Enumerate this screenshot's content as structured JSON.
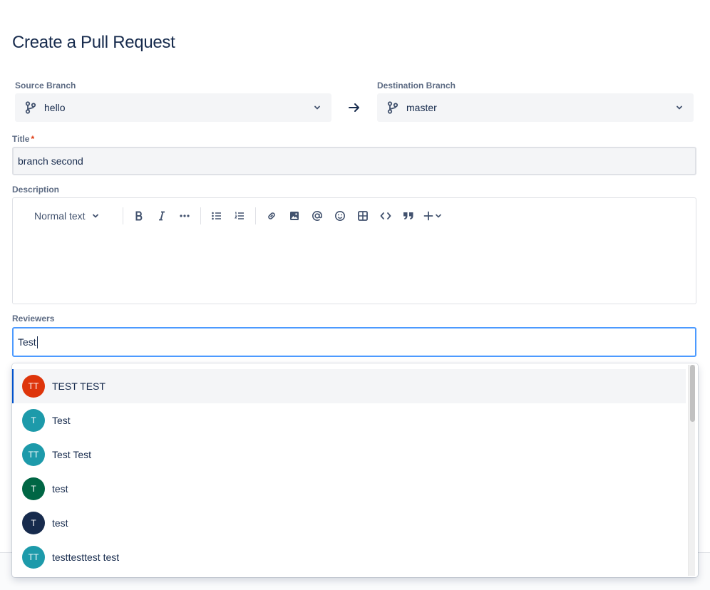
{
  "page": {
    "title": "Create a Pull Request"
  },
  "source_branch": {
    "label": "Source Branch",
    "value": "hello"
  },
  "destination_branch": {
    "label": "Destination Branch",
    "value": "master"
  },
  "title_field": {
    "label": "Title",
    "required_mark": "*",
    "value": "branch second"
  },
  "description": {
    "label": "Description",
    "toolbar": {
      "text_style": "Normal text",
      "buttons": [
        "bold-icon",
        "italic-icon",
        "more-formatting-icon",
        "bullet-list-icon",
        "numbered-list-icon",
        "link-icon",
        "image-icon",
        "mention-icon",
        "emoji-icon",
        "table-icon",
        "code-icon",
        "quote-icon",
        "insert-plus-icon"
      ]
    }
  },
  "reviewers": {
    "label": "Reviewers",
    "value": "Test",
    "suggestions": [
      {
        "initials": "TT",
        "name": "TEST TEST",
        "color": "#de350b"
      },
      {
        "initials": "T",
        "name": "Test",
        "color": "#1d9aaa"
      },
      {
        "initials": "TT",
        "name": "Test Test",
        "color": "#1d9aaa"
      },
      {
        "initials": "T",
        "name": "test",
        "color": "#006644"
      },
      {
        "initials": "T",
        "name": "test",
        "color": "#172b4d"
      },
      {
        "initials": "TT",
        "name": "testtesttest test",
        "color": "#1d9aaa"
      }
    ]
  },
  "colors": {
    "focus": "#4c9aff",
    "selected_accent": "#0052cc",
    "required": "#de350b"
  }
}
